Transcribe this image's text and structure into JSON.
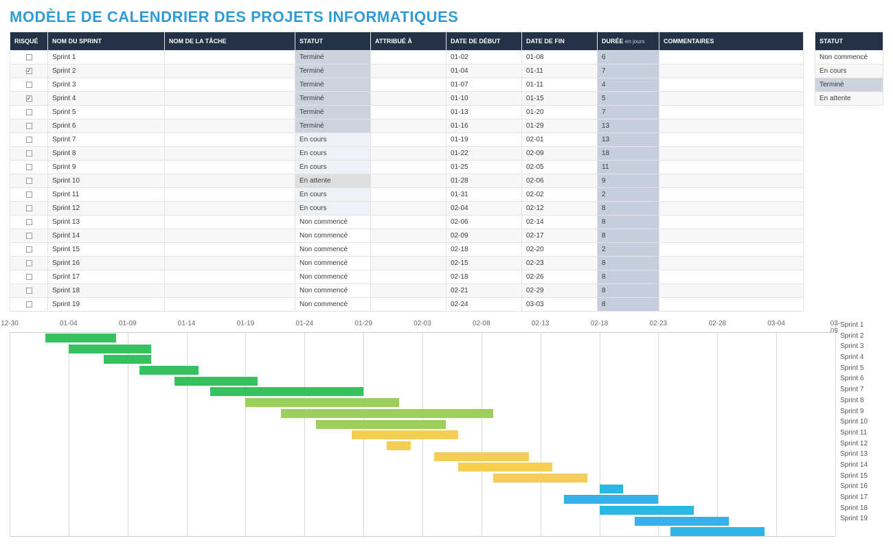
{
  "title": "MODÈLE DE CALENDRIER DES PROJETS INFORMATIQUES",
  "columns": {
    "risk": "RISQUÉ",
    "sprint": "NOM DU SPRINT",
    "task": "NOM DE LA TÂCHE",
    "status": "STATUT",
    "assignee": "ATTRIBUÉ À",
    "start": "DATE DE DÉBUT",
    "end": "DATE DE FIN",
    "dur": "DURÉE",
    "dur_sub": "en jours",
    "comments": "COMMENTAIRES"
  },
  "legend_header": "STATUT",
  "legend": [
    "Non commencé",
    "En cours",
    "Terminé",
    "En attente"
  ],
  "rows": [
    {
      "risk": false,
      "sprint": "Sprint 1",
      "task": "",
      "status": "Terminé",
      "assignee": "",
      "start": "01-02",
      "end": "01-08",
      "dur": "6",
      "comments": ""
    },
    {
      "risk": true,
      "sprint": "Sprint 2",
      "task": "",
      "status": "Terminé",
      "assignee": "",
      "start": "01-04",
      "end": "01-11",
      "dur": "7",
      "comments": ""
    },
    {
      "risk": false,
      "sprint": "Sprint 3",
      "task": "",
      "status": "Terminé",
      "assignee": "",
      "start": "01-07",
      "end": "01-11",
      "dur": "4",
      "comments": ""
    },
    {
      "risk": true,
      "sprint": "Sprint 4",
      "task": "",
      "status": "Terminé",
      "assignee": "",
      "start": "01-10",
      "end": "01-15",
      "dur": "5",
      "comments": ""
    },
    {
      "risk": false,
      "sprint": "Sprint 5",
      "task": "",
      "status": "Terminé",
      "assignee": "",
      "start": "01-13",
      "end": "01-20",
      "dur": "7",
      "comments": ""
    },
    {
      "risk": false,
      "sprint": "Sprint 6",
      "task": "",
      "status": "Terminé",
      "assignee": "",
      "start": "01-16",
      "end": "01-29",
      "dur": "13",
      "comments": ""
    },
    {
      "risk": false,
      "sprint": "Sprint 7",
      "task": "",
      "status": "En cours",
      "assignee": "",
      "start": "01-19",
      "end": "02-01",
      "dur": "13",
      "comments": ""
    },
    {
      "risk": false,
      "sprint": "Sprint 8",
      "task": "",
      "status": "En cours",
      "assignee": "",
      "start": "01-22",
      "end": "02-09",
      "dur": "18",
      "comments": ""
    },
    {
      "risk": false,
      "sprint": "Sprint 9",
      "task": "",
      "status": "En cours",
      "assignee": "",
      "start": "01-25",
      "end": "02-05",
      "dur": "11",
      "comments": ""
    },
    {
      "risk": false,
      "sprint": "Sprint 10",
      "task": "",
      "status": "En attente",
      "assignee": "",
      "start": "01-28",
      "end": "02-06",
      "dur": "9",
      "comments": ""
    },
    {
      "risk": false,
      "sprint": "Sprint 11",
      "task": "",
      "status": "En cours",
      "assignee": "",
      "start": "01-31",
      "end": "02-02",
      "dur": "2",
      "comments": ""
    },
    {
      "risk": false,
      "sprint": "Sprint 12",
      "task": "",
      "status": "En cours",
      "assignee": "",
      "start": "02-04",
      "end": "02-12",
      "dur": "8",
      "comments": ""
    },
    {
      "risk": false,
      "sprint": "Sprint 13",
      "task": "",
      "status": "Non commencé",
      "assignee": "",
      "start": "02-06",
      "end": "02-14",
      "dur": "8",
      "comments": ""
    },
    {
      "risk": false,
      "sprint": "Sprint 14",
      "task": "",
      "status": "Non commencé",
      "assignee": "",
      "start": "02-09",
      "end": "02-17",
      "dur": "8",
      "comments": ""
    },
    {
      "risk": false,
      "sprint": "Sprint 15",
      "task": "",
      "status": "Non commencé",
      "assignee": "",
      "start": "02-18",
      "end": "02-20",
      "dur": "2",
      "comments": ""
    },
    {
      "risk": false,
      "sprint": "Sprint 16",
      "task": "",
      "status": "Non commencé",
      "assignee": "",
      "start": "02-15",
      "end": "02-23",
      "dur": "8",
      "comments": ""
    },
    {
      "risk": false,
      "sprint": "Sprint 17",
      "task": "",
      "status": "Non commencé",
      "assignee": "",
      "start": "02-18",
      "end": "02-26",
      "dur": "8",
      "comments": ""
    },
    {
      "risk": false,
      "sprint": "Sprint 18",
      "task": "",
      "status": "Non commencé",
      "assignee": "",
      "start": "02-21",
      "end": "02-29",
      "dur": "8",
      "comments": ""
    },
    {
      "risk": false,
      "sprint": "Sprint 19",
      "task": "",
      "status": "Non commencé",
      "assignee": "",
      "start": "02-24",
      "end": "03-03",
      "dur": "8",
      "comments": ""
    }
  ],
  "chart_data": {
    "type": "gantt",
    "x_ticks": [
      "12-30",
      "01-04",
      "01-09",
      "01-14",
      "01-19",
      "01-24",
      "01-29",
      "02-03",
      "02-08",
      "02-13",
      "02-18",
      "02-23",
      "02-28",
      "03-04",
      "03-09"
    ],
    "x_min": "12-30",
    "x_max": "03-09",
    "series": [
      {
        "name": "Sprint 1",
        "start": "01-02",
        "end": "01-08",
        "status": "Terminé"
      },
      {
        "name": "Sprint 2",
        "start": "01-04",
        "end": "01-11",
        "status": "Terminé"
      },
      {
        "name": "Sprint 3",
        "start": "01-07",
        "end": "01-11",
        "status": "Terminé"
      },
      {
        "name": "Sprint 4",
        "start": "01-10",
        "end": "01-15",
        "status": "Terminé"
      },
      {
        "name": "Sprint 5",
        "start": "01-13",
        "end": "01-20",
        "status": "Terminé"
      },
      {
        "name": "Sprint 6",
        "start": "01-16",
        "end": "01-29",
        "status": "Terminé"
      },
      {
        "name": "Sprint 7",
        "start": "01-19",
        "end": "02-01",
        "status": "En cours"
      },
      {
        "name": "Sprint 8",
        "start": "01-22",
        "end": "02-09",
        "status": "En cours"
      },
      {
        "name": "Sprint 9",
        "start": "01-25",
        "end": "02-05",
        "status": "En cours"
      },
      {
        "name": "Sprint 10",
        "start": "01-28",
        "end": "02-06",
        "status": "En attente"
      },
      {
        "name": "Sprint 11",
        "start": "01-31",
        "end": "02-02",
        "status": "En attente"
      },
      {
        "name": "Sprint 12",
        "start": "02-04",
        "end": "02-12",
        "status": "En attente"
      },
      {
        "name": "Sprint 13",
        "start": "02-06",
        "end": "02-14",
        "status": "En attente"
      },
      {
        "name": "Sprint 14",
        "start": "02-09",
        "end": "02-17",
        "status": "En attente"
      },
      {
        "name": "Sprint 15",
        "start": "02-18",
        "end": "02-20",
        "status": "Non commencé"
      },
      {
        "name": "Sprint 16",
        "start": "02-15",
        "end": "02-23",
        "status": "Non commencé"
      },
      {
        "name": "Sprint 17",
        "start": "02-18",
        "end": "02-26",
        "status": "Non commencé"
      },
      {
        "name": "Sprint 18",
        "start": "02-21",
        "end": "02-29",
        "status": "Non commencé"
      },
      {
        "name": "Sprint 19",
        "start": "02-24",
        "end": "03-03",
        "status": "Non commencé"
      }
    ],
    "color_map": {
      "Terminé": "#36c35f",
      "En cours": "#9cce5b",
      "En attente": "#f4ce55",
      "Non commencé": "#30b4e6"
    }
  }
}
